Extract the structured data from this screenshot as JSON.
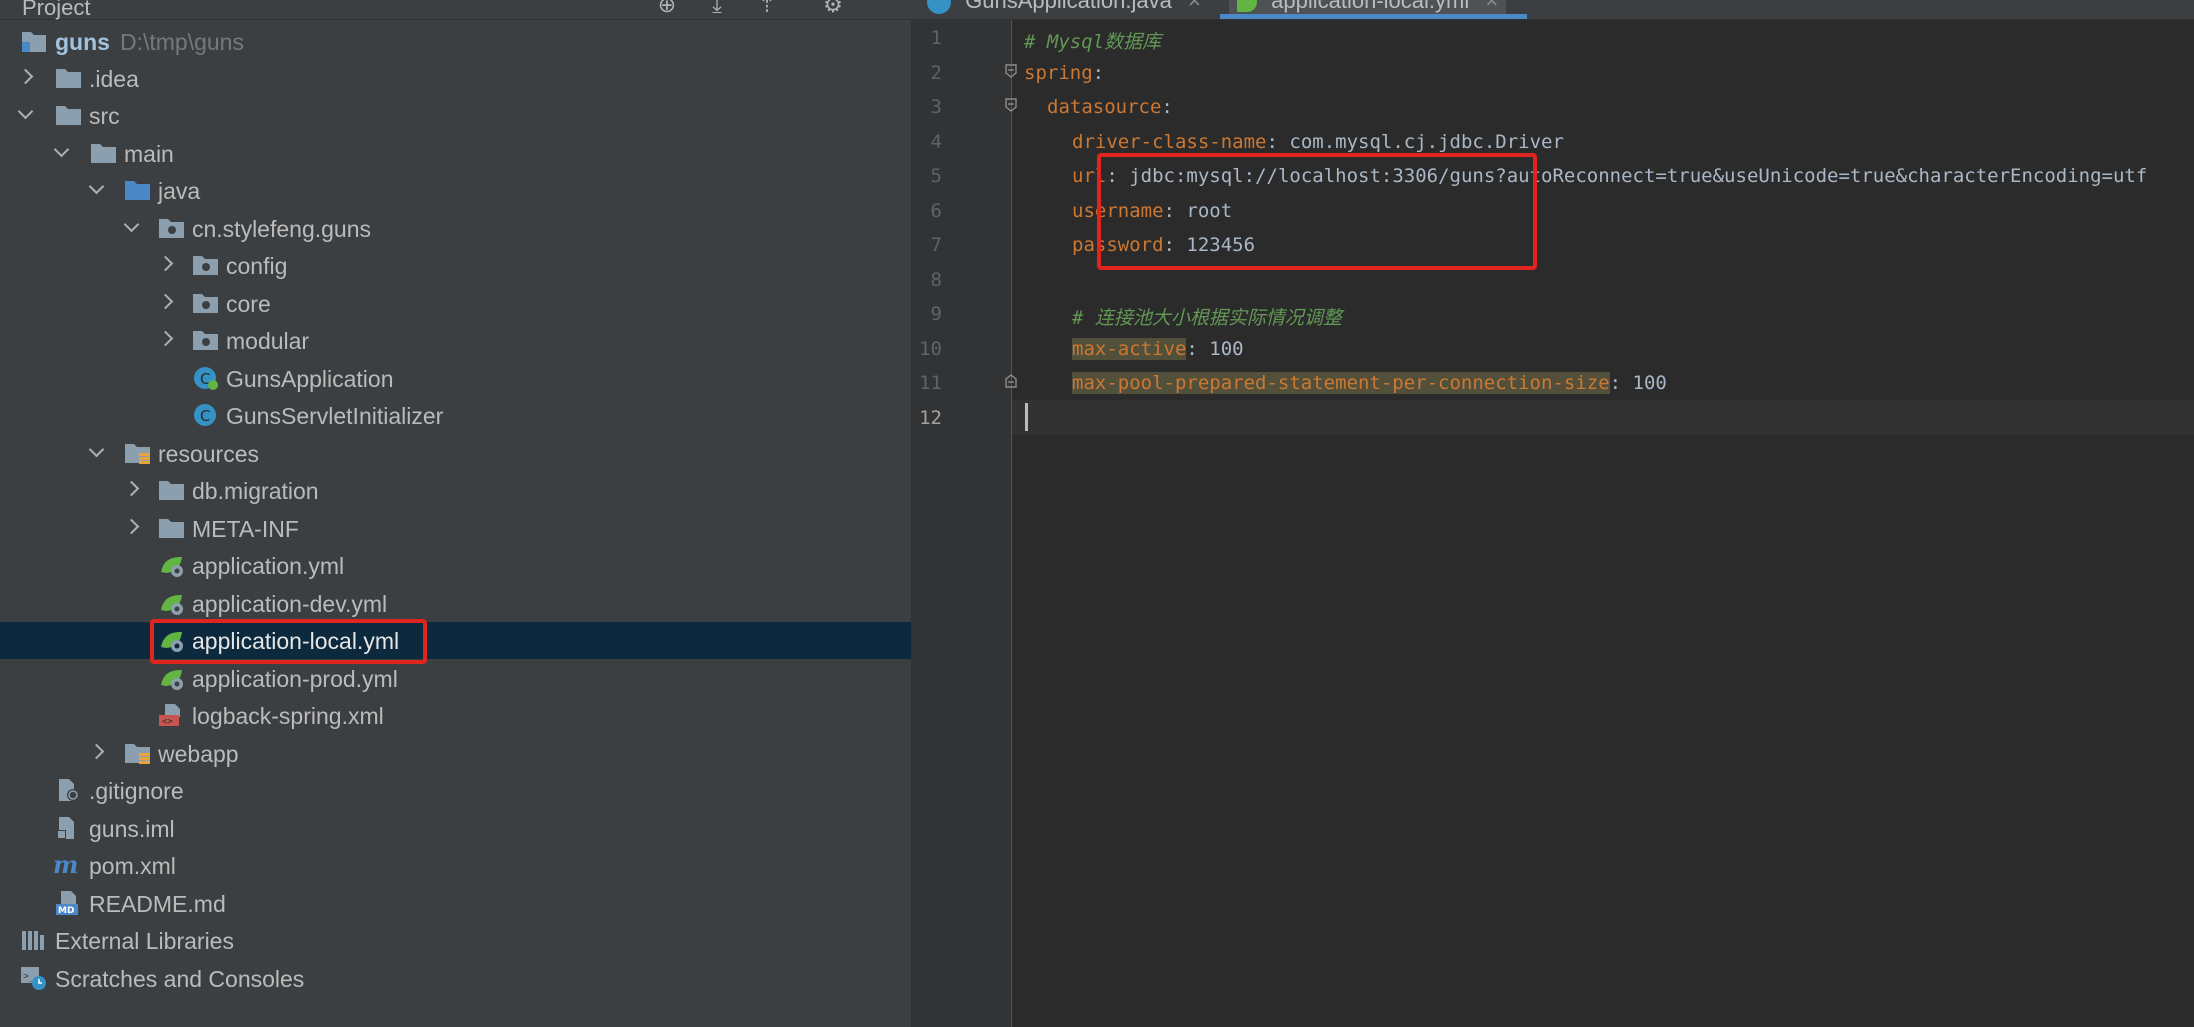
{
  "project_panel": {
    "title": "Project",
    "tree": [
      {
        "label": "guns",
        "path": "D:\\tmp\\guns"
      },
      {
        "label": ".idea"
      },
      {
        "label": "src"
      },
      {
        "label": "main"
      },
      {
        "label": "java"
      },
      {
        "label": "cn.stylefeng.guns"
      },
      {
        "label": "config"
      },
      {
        "label": "core"
      },
      {
        "label": "modular"
      },
      {
        "label": "GunsApplication"
      },
      {
        "label": "GunsServletInitializer"
      },
      {
        "label": "resources"
      },
      {
        "label": "db.migration"
      },
      {
        "label": "META-INF"
      },
      {
        "label": "application.yml"
      },
      {
        "label": "application-dev.yml"
      },
      {
        "label": "application-local.yml"
      },
      {
        "label": "application-prod.yml"
      },
      {
        "label": "logback-spring.xml"
      },
      {
        "label": "webapp"
      },
      {
        "label": ".gitignore"
      },
      {
        "label": "guns.iml"
      },
      {
        "label": "pom.xml"
      },
      {
        "label": "README.md"
      },
      {
        "label": "External Libraries"
      },
      {
        "label": "Scratches and Consoles"
      }
    ]
  },
  "editor": {
    "tabs": [
      {
        "label": "GunsApplication.java",
        "close": "×"
      },
      {
        "label": "application-local.yml",
        "close": "×"
      }
    ],
    "line_numbers": [
      "1",
      "2",
      "3",
      "4",
      "5",
      "6",
      "7",
      "8",
      "9",
      "10",
      "11",
      "12"
    ],
    "code": {
      "comment1": "# Mysql数据库",
      "spring_key": "spring",
      "datasource_key": "datasource",
      "driver_key": "driver-class-name",
      "driver_value": "com.mysql.cj.jdbc.Driver",
      "url_key": "url",
      "url_value": "jdbc:mysql://localhost:3306/guns?autoReconnect=true&useUnicode=true&characterEncoding=utf",
      "username_key": "username",
      "username_value": "root",
      "password_key": "password",
      "password_value": "123456",
      "comment2": "# 连接池大小根据实际情况调整",
      "max_active_key": "max-active",
      "max_active_value": "100",
      "max_pool_key": "max-pool-prepared-statement-per-connection-size",
      "max_pool_value": "100",
      "colon": ":"
    }
  },
  "colors": {
    "highlight_box": "#e0251f",
    "selection": "#0d293e",
    "keyword": "#cc7832",
    "comment": "#629755"
  }
}
